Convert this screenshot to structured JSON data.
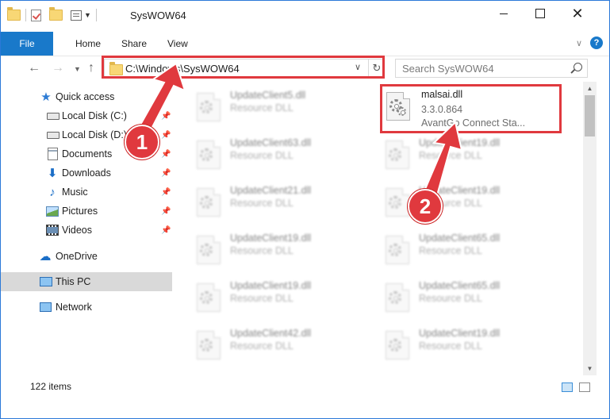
{
  "window": {
    "title": "SysWOW64"
  },
  "ribbon": {
    "tabs": [
      "File",
      "Home",
      "Share",
      "View"
    ]
  },
  "address": {
    "path": "C:\\Windows\\SysWOW64"
  },
  "search": {
    "placeholder": "Search SysWOW64"
  },
  "sidebar": {
    "items": [
      {
        "label": "Quick access",
        "icon": "star-icon"
      },
      {
        "label": "Local Disk (C:)",
        "icon": "drive-icon"
      },
      {
        "label": "Local Disk (D:)",
        "icon": "drive-icon"
      },
      {
        "label": "Documents",
        "icon": "documents-icon"
      },
      {
        "label": "Downloads",
        "icon": "download-icon"
      },
      {
        "label": "Music",
        "icon": "music-icon"
      },
      {
        "label": "Pictures",
        "icon": "pictures-icon"
      },
      {
        "label": "Videos",
        "icon": "videos-icon"
      },
      {
        "label": "OneDrive",
        "icon": "cloud-icon"
      },
      {
        "label": "This PC",
        "icon": "computer-icon"
      },
      {
        "label": "Network",
        "icon": "network-icon"
      }
    ]
  },
  "files": {
    "highlighted": {
      "name": "malsai.dll",
      "version": "3.3.0.864",
      "description": "AvantGo Connect Sta..."
    },
    "left_column": [
      {
        "name": "UpdateClient5.dll",
        "type": "Resource DLL"
      },
      {
        "name": "UpdateClient63.dll",
        "type": "Resource DLL"
      },
      {
        "name": "UpdateClient21.dll",
        "type": "Resource DLL"
      },
      {
        "name": "UpdateClient19.dll",
        "type": "Resource DLL"
      },
      {
        "name": "UpdateClient19.dll",
        "type": "Resource DLL"
      },
      {
        "name": "UpdateClient42.dll",
        "type": "Resource DLL"
      }
    ],
    "right_column": [
      {
        "name": "UpdateClient19.dll",
        "type": "Resource DLL"
      },
      {
        "name": "UpdateClient19.dll",
        "type": "Resource DLL"
      },
      {
        "name": "UpdateClient65.dll",
        "type": "Resource DLL"
      },
      {
        "name": "UpdateClient65.dll",
        "type": "Resource DLL"
      },
      {
        "name": "UpdateClient19.dll",
        "type": "Resource DLL"
      }
    ]
  },
  "status": {
    "item_count": "122 items"
  },
  "callouts": [
    "1",
    "2"
  ],
  "colors": {
    "accent": "#1979ca",
    "highlight_red": "#e0393e",
    "selected_bg": "#d9d9d9"
  }
}
